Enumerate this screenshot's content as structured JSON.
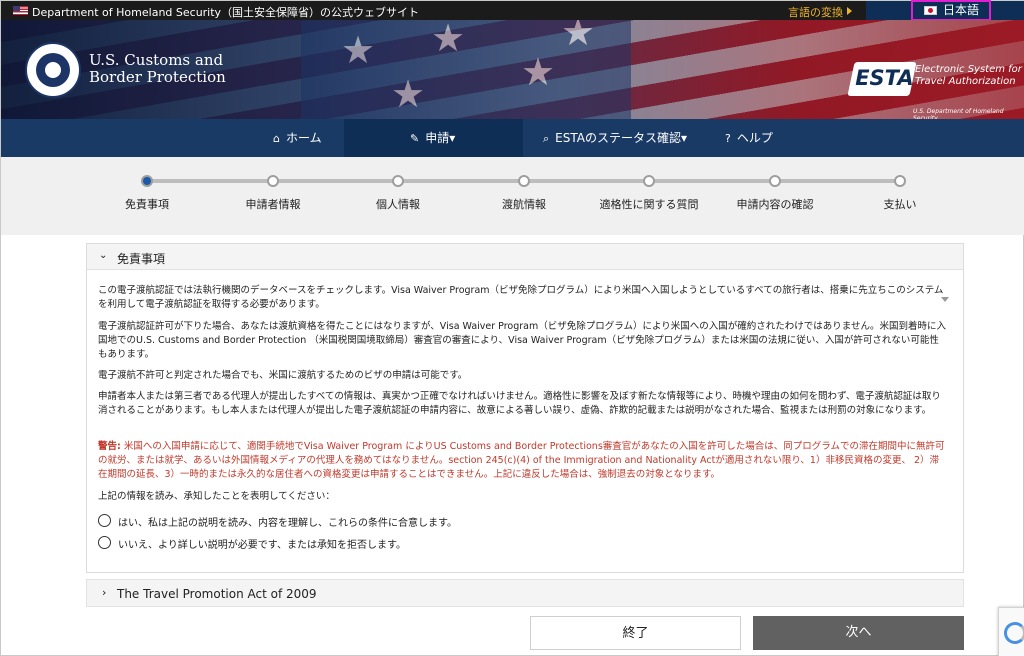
{
  "topbar": {
    "notice": "Department of Homeland Security（国土安全保障省）の公式ウェブサイト",
    "language_change": "言語の変換",
    "current_language": "日本語"
  },
  "header": {
    "agency_line1": "U.S. Customs and",
    "agency_line2": "Border Protection",
    "logo_text": "ESTA",
    "esta_line1": "Electronic System for",
    "esta_line2": "Travel Authorization",
    "esta_sub": "U.S. Department of Homeland Security"
  },
  "nav": {
    "items": [
      {
        "label": "ホーム",
        "icon": "home-icon"
      },
      {
        "label": "申請▾",
        "icon": "pencil-icon"
      },
      {
        "label": "ESTAのステータス確認▾",
        "icon": "search-icon"
      },
      {
        "label": "ヘルプ",
        "icon": "help-icon"
      }
    ],
    "active_index": 1
  },
  "progress": {
    "steps": [
      "免責事項",
      "申請者情報",
      "個人情報",
      "渡航情報",
      "適格性に関する質問",
      "申請内容の確認",
      "支払い"
    ],
    "current_index": 0
  },
  "disclaimer": {
    "title": "免責事項",
    "paragraphs": [
      "この電子渡航認証では法執行機関のデータベースをチェックします。Visa Waiver Program（ビザ免除プログラム）により米国へ入国しようとしているすべての旅行者は、搭乗に先立ちこのシステムを利用して電子渡航認証を取得する必要があります。",
      "電子渡航認証許可が下りた場合、あなたは渡航資格を得たことにはなりますが、Visa Waiver Program（ビザ免除プログラム）により米国への入国が確約されたわけではありません。米国到着時に入国地でのU.S. Customs and Border Protection （米国税関国境取締局）審査官の審査により、Visa Waiver Program（ビザ免除プログラム）または米国の法規に従い、入国が許可されない可能性もあります。",
      "電子渡航不許可と判定された場合でも、米国に渡航するためのビザの申請は可能です。",
      "申請者本人または第三者である代理人が提出したすべての情報は、真実かつ正確でなければいけません。適格性に影響を及ぼす新たな情報等により、時機や理由の如何を問わず、電子渡航認証は取り消されることがあります。もし本人または代理人が提出した電子渡航認証の申請内容に、故意による著しい誤り、虚偽、詐欺的記載または説明がなされた場合、監視または刑罰の対象になります。"
    ],
    "warning_label": "警告:",
    "warning_text": " 米国への入国申請に応じて、適関手続地でVisa Waiver Program によりUS Customs and Border Protections審査官があなたの入国を許可した場合は、同プログラムでの滞在期間中に無許可の就労、または就学、あるいは外国情報メディアの代理人を務めてはなりません。section 245(c)(4) of the Immigration and Nationality Actが適用されない限り、1）非移民資格の変更、 2）滞在期間の延長、3）一時的または永久的な居住者への資格変更は申請することはできません。上記に違反した場合は、強制退去の対象となります。",
    "prompt": "上記の情報を読み、承知したことを表明してください：",
    "options": [
      "はい、私は上記の説明を読み、内容を理解し、これらの条件に合意します。",
      "いいえ、より詳しい説明が必要です、または承知を拒否します。"
    ]
  },
  "travel_promotion": {
    "title": "The Travel Promotion Act of 2009"
  },
  "buttons": {
    "quit": "終了",
    "next": "次へ"
  }
}
